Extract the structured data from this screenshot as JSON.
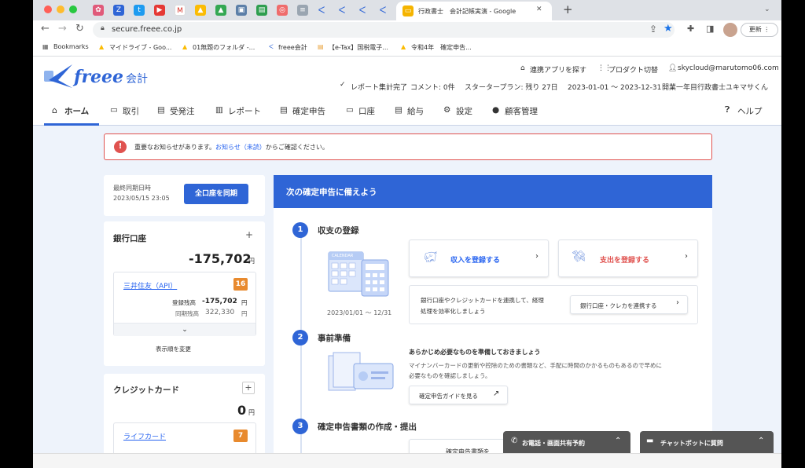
{
  "browser": {
    "active_tab_title": "行政書士　会計記帳実演 - Google",
    "url": "secure.freee.co.jp",
    "update_label": "更新"
  },
  "bookmarks": [
    "Bookmarks",
    "マイドライブ - Goo...",
    "01無題のフォルダ -...",
    "freee会計",
    "【e-Tax】国税電子...",
    "令和4年　確定申告..."
  ],
  "header": {
    "logo_text": "freee",
    "logo_sub": "会計",
    "links": [
      "連携アプリを探す",
      "プロダクト切替",
      "skycloud@marutomo06.com"
    ],
    "status": [
      "レポート集計完了",
      "コメント: 0件",
      "スタータープラン: 残り 27日",
      "2023-01-01 〜 2023-12-31",
      "開業一年目行政書士ユキマサくん"
    ]
  },
  "nav": [
    "ホーム",
    "取引",
    "受発注",
    "レポート",
    "確定申告",
    "口座",
    "給与",
    "設定",
    "顧客管理"
  ],
  "help": "ヘルプ",
  "alert": {
    "pre": "重要なお知らせがあります。",
    "link": "お知らせ（未読）",
    "post": "からご確認ください。"
  },
  "sync": {
    "label": "最終同期日時",
    "datetime": "2023/05/15 23:05",
    "button": "全口座を同期"
  },
  "bank": {
    "title": "銀行口座",
    "total": "-175,702",
    "yen": "円",
    "account_name": "三井住友（API）",
    "badge": "16",
    "reg_label": "登録残高",
    "reg_value": "-175,702",
    "sync_label": "同期残高",
    "sync_value": "322,330",
    "reorder": "表示順を変更"
  },
  "credit": {
    "title": "クレジットカード",
    "total": "0",
    "yen": "円",
    "card_name": "ライフカード",
    "badge": "7"
  },
  "prep": {
    "title": "次の確定申告に備えよう",
    "step1_title": "収支の登録",
    "income_btn": "収入を登録する",
    "expense_btn": "支出を登録する",
    "calendar_text": "CALENDAR",
    "period": "2023/01/01 〜 12/31",
    "link_text1": "銀行口座やクレジットカードを連携して、経理",
    "link_text2": "処理を効率化しましょう",
    "link_btn": "銀行口座・クレカを連携する",
    "step2_title": "事前準備",
    "step2_head": "あらかじめ必要なものを準備しておきましょう",
    "step2_desc1": "マイナンバーカードの更新や控除のための書類など、手配に時間のかかるものもあるので早めに",
    "step2_desc2": "必要なものを確認しましょう。",
    "guide_btn": "確定申告ガイドを見る",
    "step3_title": "確定申告書類の作成・提出",
    "step3_partial": "確定申告書類を"
  },
  "floating": {
    "phone": "お電話・画面共有予約",
    "chat": "チャットボットに質問"
  },
  "colors": {
    "brand": "#2f65d6",
    "alert_red": "#e0524f",
    "expense_red": "#e0524f",
    "badge_orange": "#e88a2e"
  }
}
